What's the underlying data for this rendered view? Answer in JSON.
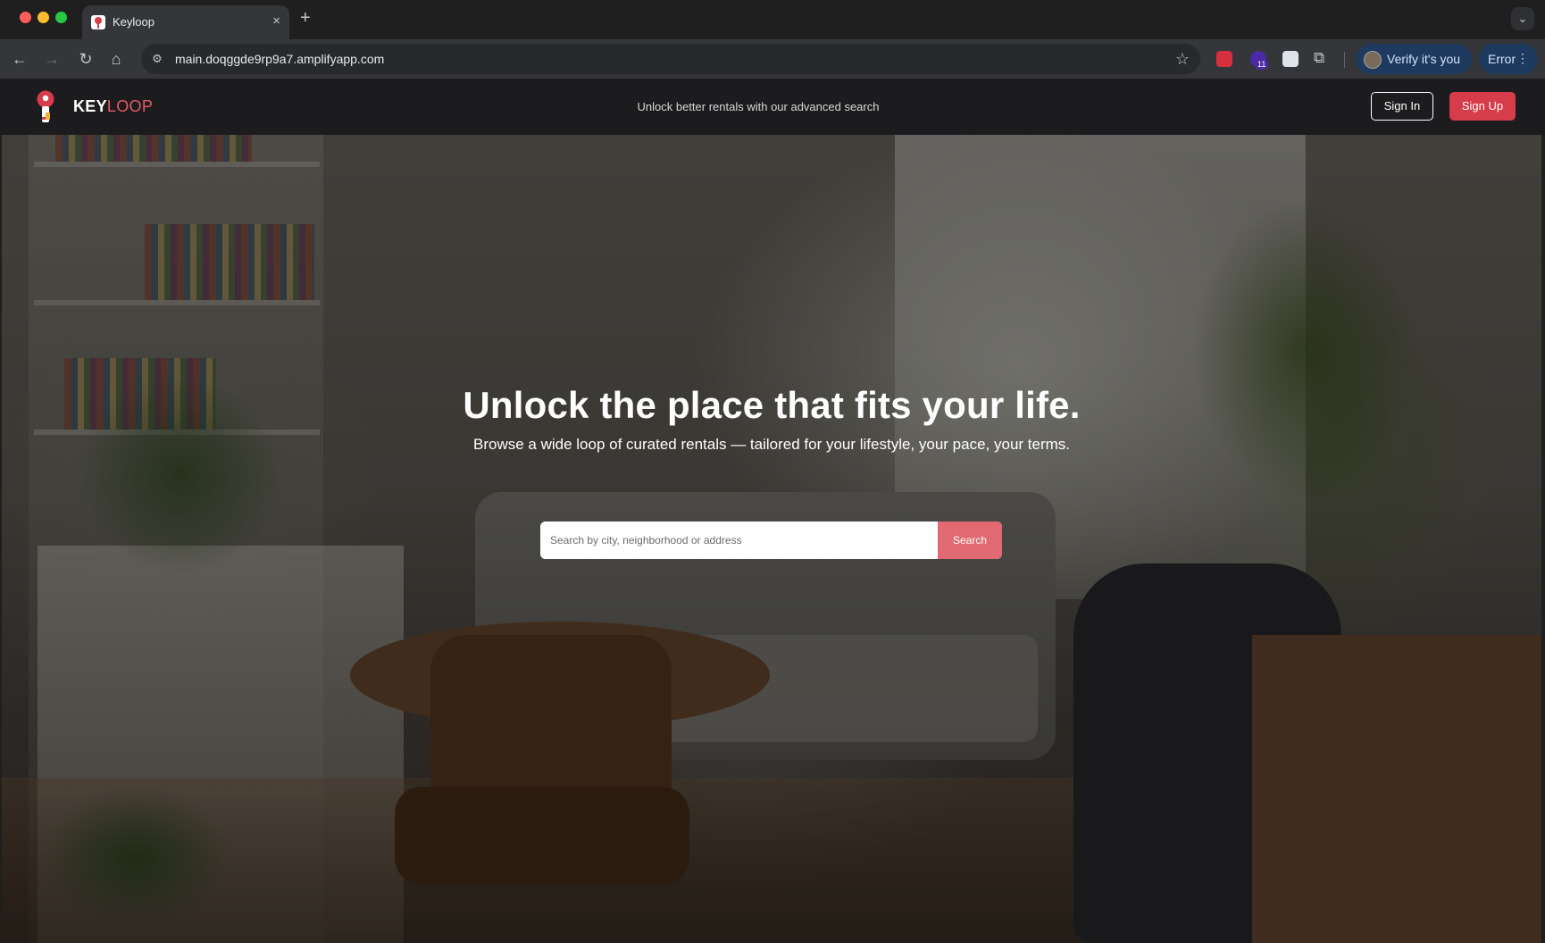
{
  "browser": {
    "tab": {
      "title": "Keyloop",
      "close_glyph": "×"
    },
    "new_tab_glyph": "+",
    "tab_menu_glyph": "⌄",
    "nav": {
      "back": "←",
      "forward": "→",
      "reload": "↻",
      "home": "⌂"
    },
    "address": {
      "url": "main.doqggde9rp9a7.amplifyapp.com",
      "site_info_glyph": "⚙",
      "star_glyph": "☆"
    },
    "extensions": {
      "badge": "11",
      "puzzle_glyph": "⧉"
    },
    "profile": {
      "label": "Verify it's you"
    },
    "error": {
      "label": "Error",
      "menu_glyph": "⋮"
    }
  },
  "site": {
    "logo": {
      "key": "KEY",
      "loop": "LOOP"
    },
    "tagline": "Unlock better rentals with our advanced search",
    "sign_in": "Sign In",
    "sign_up": "Sign Up"
  },
  "hero": {
    "title": "Unlock the place that fits your life.",
    "subtitle": "Browse a wide loop of curated rentals — tailored for your lifestyle, your pace, your terms.",
    "search": {
      "placeholder": "Search by city, neighborhood or address",
      "value": "",
      "button": "Search"
    }
  },
  "colors": {
    "brand_red": "#d73c4b",
    "search_button": "#e16a72",
    "header_bg": "#1c1c1e",
    "chrome_bg": "#35363a"
  },
  "icons": [
    "keyloop-logo-icon",
    "back-icon",
    "forward-icon",
    "reload-icon",
    "home-icon",
    "site-info-icon",
    "star-icon",
    "extension-icon",
    "puzzle-icon",
    "profile-avatar-icon",
    "more-icon",
    "close-icon",
    "plus-icon"
  ]
}
